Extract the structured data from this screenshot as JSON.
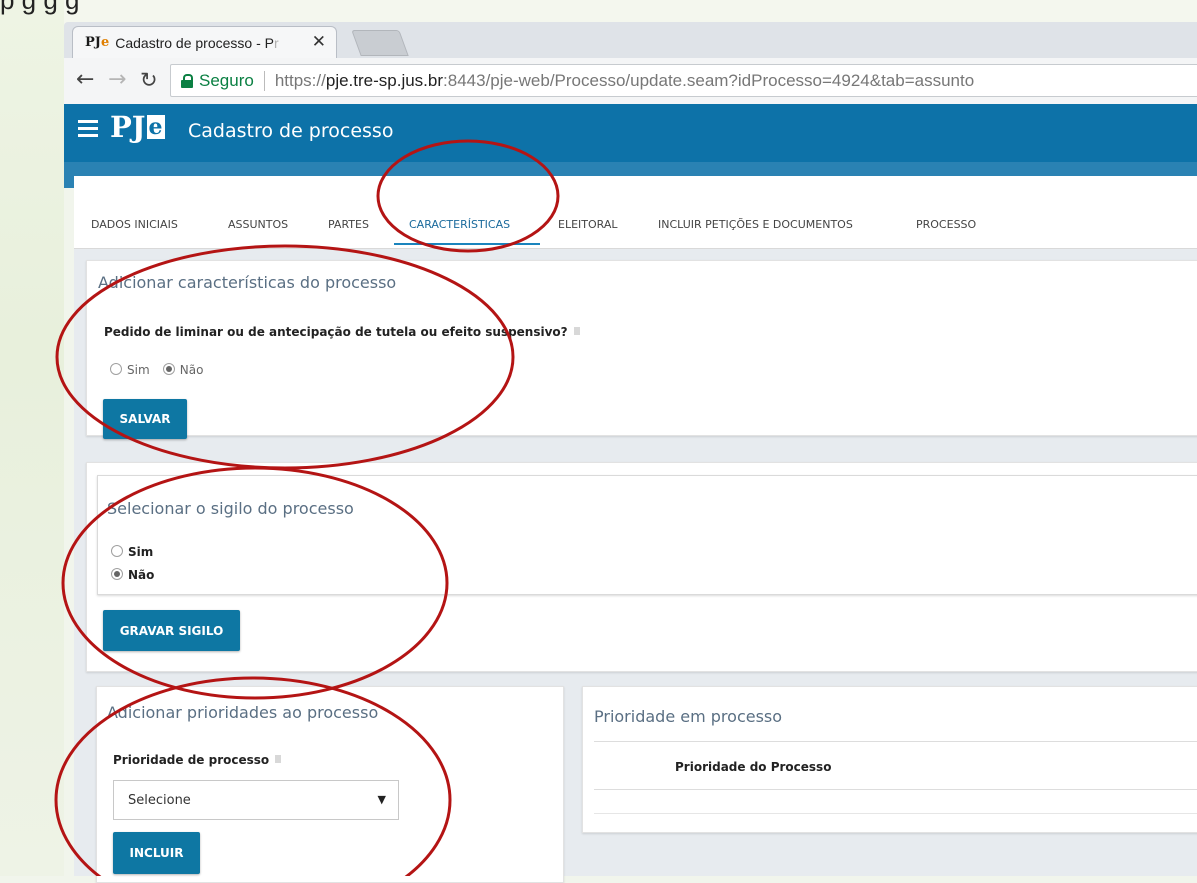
{
  "caption_text": "p                     g     g         g",
  "browser": {
    "tab_title_main": "Cadastro de processo - P",
    "tab_title_fade": "r",
    "favicon_text": "PJ",
    "favicon_e": "e",
    "secure_label": "Seguro",
    "url_scheme": "https://",
    "url_host": "pje.tre-sp.jus.br",
    "url_rest": ":8443/pje-web/Processo/update.seam?idProcesso=4924&tab=assunto"
  },
  "app": {
    "logo_pj": "PJ",
    "logo_e": "e",
    "title": "Cadastro de processo"
  },
  "tabs": [
    {
      "label": "DADOS INICIAIS"
    },
    {
      "label": "ASSUNTOS"
    },
    {
      "label": "PARTES"
    },
    {
      "label": "CARACTERÍSTICAS"
    },
    {
      "label": "ELEITORAL"
    },
    {
      "label": "INCLUIR PETIÇÕES E DOCUMENTOS"
    },
    {
      "label": "PROCESSO"
    }
  ],
  "caracteristicas": {
    "title": "Adicionar características do processo",
    "question": "Pedido de liminar ou de antecipação de tutela ou efeito suspensivo?",
    "option_yes": "Sim",
    "option_no": "Não",
    "selected": "Não",
    "button": "SALVAR"
  },
  "sigilo": {
    "title": "Selecionar o sigilo do processo",
    "option_yes": "Sim",
    "option_no": "Não",
    "selected": "Não",
    "button": "GRAVAR SIGILO"
  },
  "prioridades": {
    "title": "Adicionar prioridades ao processo",
    "field_label": "Prioridade de processo",
    "select_value": "Selecione",
    "button": "INCLUIR"
  },
  "prioridade_em_processo": {
    "title": "Prioridade em processo",
    "column_header": "Prioridade do Processo"
  },
  "colors": {
    "header_blue": "#0d72a8",
    "button_blue": "#0e77a3",
    "annotation_red": "#b41414",
    "secure_green": "#0b8043"
  }
}
